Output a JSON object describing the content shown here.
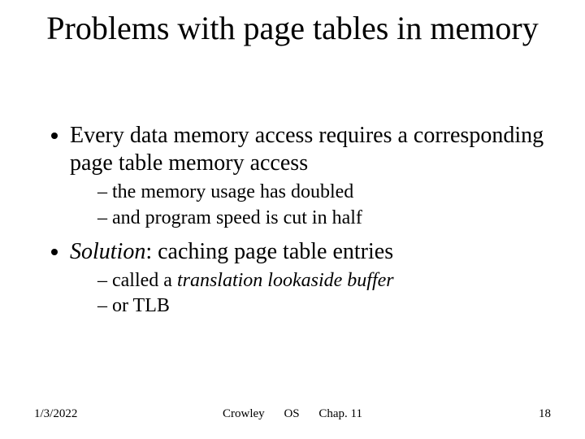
{
  "title": "Problems with page tables in memory",
  "bullets": [
    {
      "text": "Every data memory access requires a corresponding page table memory access",
      "sub": [
        "the memory usage has doubled",
        "and program speed is cut in half"
      ]
    },
    {
      "text_prefix_italic": "Solution",
      "text_rest": ": caching page table entries",
      "sub": [
        {
          "prefix": "called a ",
          "italic": "translation lookaside buffer"
        },
        {
          "prefix": "or TLB"
        }
      ]
    }
  ],
  "footer": {
    "date": "1/3/2022",
    "author": "Crowley",
    "course": "OS",
    "chapter": "Chap. 11",
    "page": "18"
  }
}
